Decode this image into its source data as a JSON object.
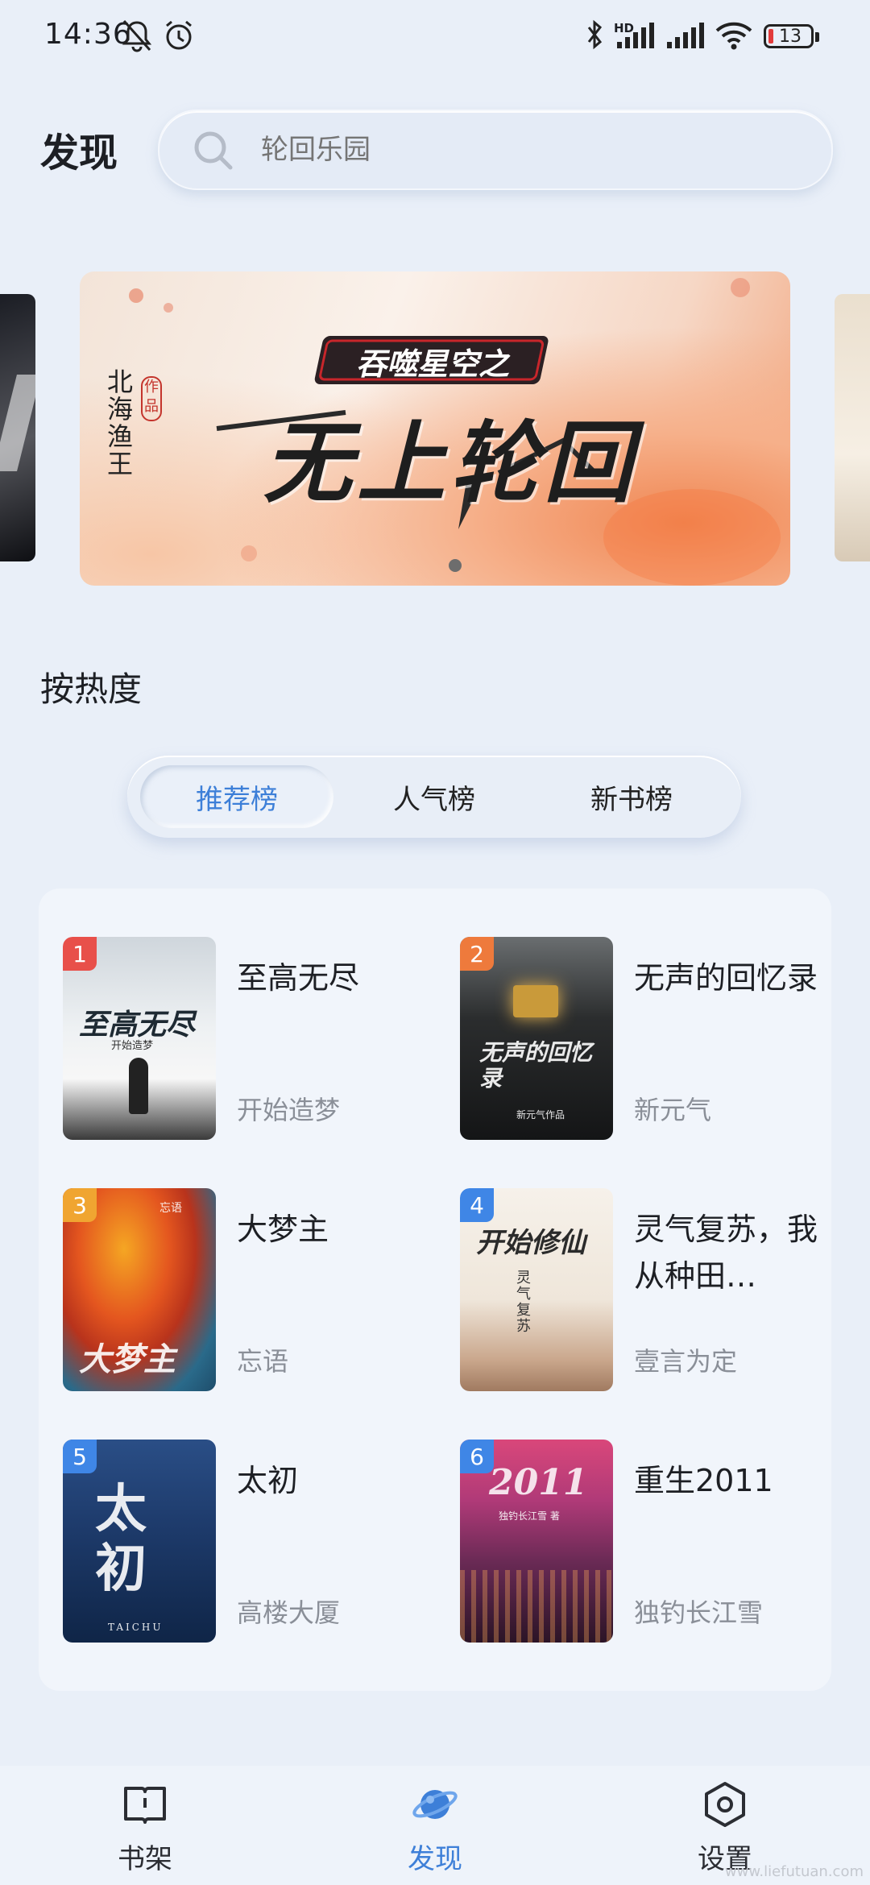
{
  "status_bar": {
    "time": "14:36",
    "battery": "13",
    "signal_badge": "HD"
  },
  "header": {
    "title": "发现",
    "search_placeholder": "轮回乐园"
  },
  "banner": {
    "author_credit": "北海渔王",
    "work_tag": "作品",
    "subtitle": "吞噬星空之",
    "headline": "无上轮回"
  },
  "section": {
    "title": "按热度"
  },
  "tabs": [
    {
      "label": "推荐榜",
      "active": true
    },
    {
      "label": "人气榜",
      "active": false
    },
    {
      "label": "新书榜",
      "active": false
    }
  ],
  "ranking": [
    {
      "rank": "1",
      "title": "至高无尽",
      "author": "开始造梦",
      "badge_color": "#e8504a",
      "cover_text": "至高无尽",
      "cover_caption": "开始造梦"
    },
    {
      "rank": "2",
      "title": "无声的回忆录",
      "author": "新元气",
      "badge_color": "#ee7a3c",
      "cover_text": "无声的回忆录",
      "cover_caption": "新元气作品"
    },
    {
      "rank": "3",
      "title": "大梦主",
      "author": "忘语",
      "badge_color": "#f0a531",
      "cover_text": "大梦主",
      "cover_caption": "忘语"
    },
    {
      "rank": "4",
      "title": "灵气复苏，我从种田…",
      "author": "壹言为定",
      "badge_color": "#3f86e6",
      "cover_text": "开始修仙",
      "cover_caption": "灵气复苏"
    },
    {
      "rank": "5",
      "title": "太初",
      "author": "高楼大厦",
      "badge_color": "#3f86e6",
      "cover_text": "太初",
      "cover_caption": "TAICHU"
    },
    {
      "rank": "6",
      "title": "重生2011",
      "author": "独钓长江雪",
      "badge_color": "#3f86e6",
      "cover_text": "2011",
      "cover_caption": "独钓长江雪 著"
    }
  ],
  "bottom_nav": [
    {
      "label": "书架",
      "icon": "book-icon",
      "active": false
    },
    {
      "label": "发现",
      "icon": "planet-icon",
      "active": true
    },
    {
      "label": "设置",
      "icon": "settings-hexagon-icon",
      "active": false
    }
  ],
  "watermark": "www.liefutuan.com",
  "colors": {
    "accent": "#3d7fd8",
    "background": "#e9eff8"
  }
}
